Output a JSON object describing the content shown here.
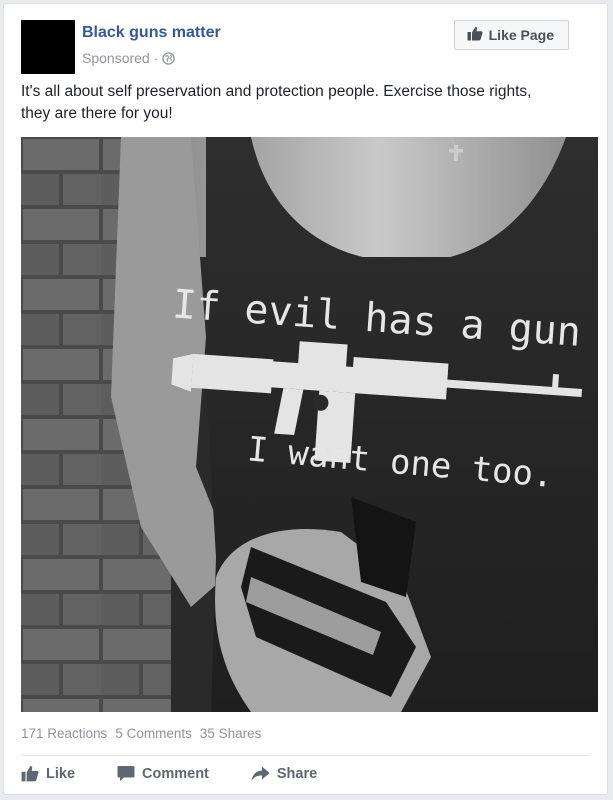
{
  "post": {
    "page_name": "Black guns matter",
    "sponsored": "Sponsored",
    "separator": "·",
    "globe_icon": "globe-icon",
    "like_page_label": "Like Page",
    "text_line1": "It's all about self preservation and protection people. Exercise those rights,",
    "text_line2": "they are there for you!"
  },
  "photo": {
    "shirt_line1": "If evil has a gun",
    "shirt_line2": "I want one too."
  },
  "stats": {
    "reactions": "171 Reactions",
    "comments": "5 Comments",
    "shares": "35 Shares"
  },
  "actions": {
    "like": "Like",
    "comment": "Comment",
    "share": "Share"
  },
  "colors": {
    "link_blue": "#365899",
    "meta_gray": "#90949c",
    "action_gray": "#606770"
  }
}
